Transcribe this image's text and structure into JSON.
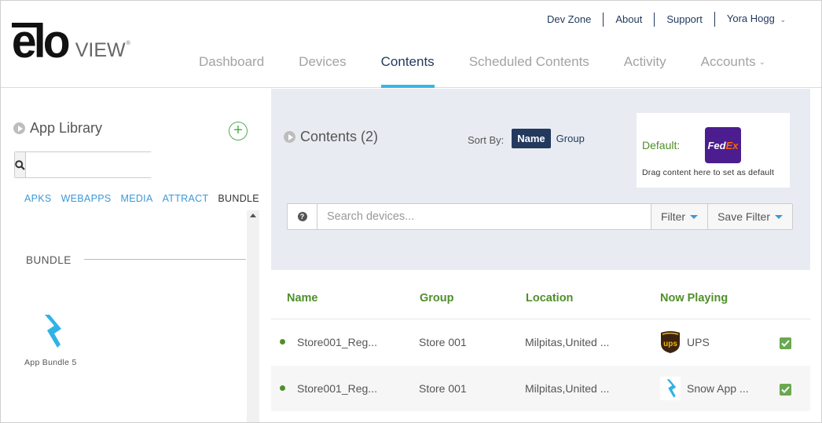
{
  "brand": {
    "logo_main": "elo",
    "logo_sub": "VIEW",
    "logo_tm": "®"
  },
  "toplinks": {
    "dev_zone": "Dev Zone",
    "about": "About",
    "support": "Support",
    "user": "Yora Hogg"
  },
  "nav": [
    {
      "label": "Dashboard"
    },
    {
      "label": "Devices"
    },
    {
      "label": "Contents",
      "active": true
    },
    {
      "label": "Scheduled Contents"
    },
    {
      "label": "Activity"
    },
    {
      "label": "Accounts"
    }
  ],
  "library": {
    "title": "App Library",
    "search_placeholder": "",
    "tabs": [
      "APKS",
      "WEBAPPS",
      "MEDIA",
      "ATTRACT",
      "BUNDLE"
    ],
    "selected_tab": "BUNDLE",
    "section": "BUNDLE",
    "items": [
      {
        "label": "App Bundle 5"
      }
    ]
  },
  "contents": {
    "title": "Contents (2)",
    "sort_label": "Sort By:",
    "sort_options": [
      "Name",
      "Group"
    ],
    "default_label": "Default:",
    "default_hint": "Drag content here to set as default",
    "default_icon_text_1": "Fed",
    "default_icon_text_2": "Ex",
    "search_placeholder": "Search devices...",
    "filter_label": "Filter",
    "save_filter_label": "Save Filter"
  },
  "table": {
    "headers": [
      "Name",
      "Group",
      "Location",
      "Now Playing"
    ],
    "rows": [
      {
        "name": "Store001_Reg...",
        "group": "Store 001",
        "location": "Milpitas,United ...",
        "now_playing": "UPS",
        "icon": "ups-icon"
      },
      {
        "name": "Store001_Reg...",
        "group": "Store 001",
        "location": "Milpitas,United ...",
        "now_playing": "Snow App ...",
        "icon": "snow-app-icon"
      }
    ]
  },
  "colors": {
    "navy": "#233a5e",
    "accent_blue": "#36b6e6",
    "green": "#4f8f2a",
    "link_blue": "#3d98d8"
  }
}
